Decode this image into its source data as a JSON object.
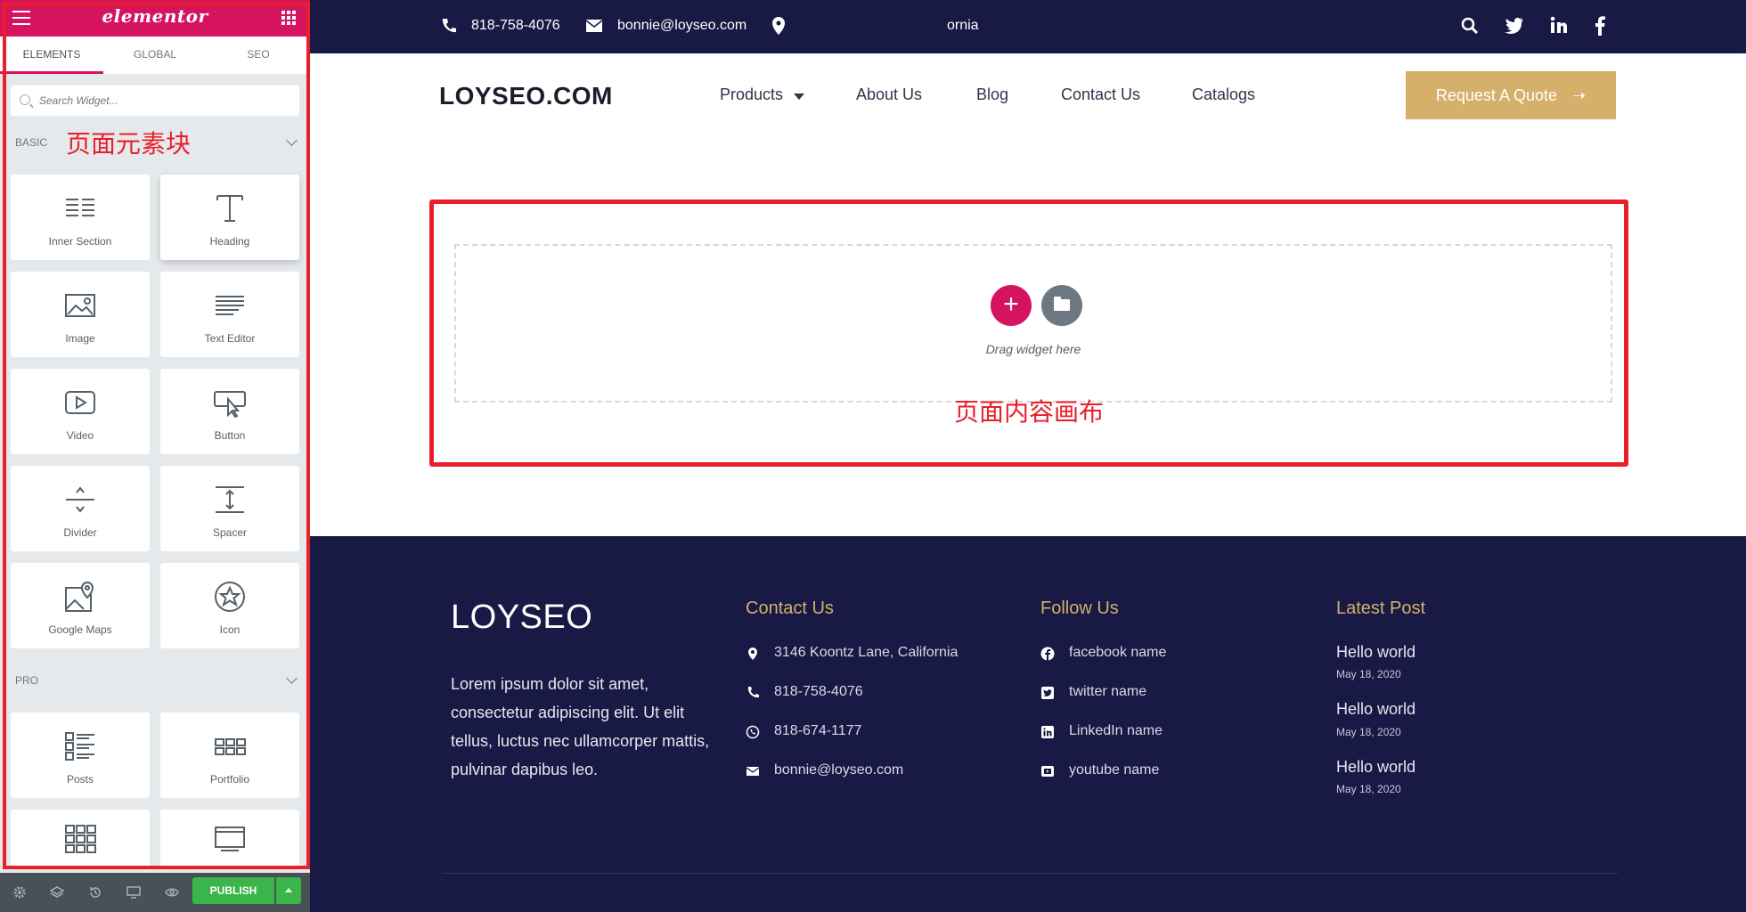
{
  "editor": {
    "logo": "elementor",
    "tabs": [
      "ELEMENTS",
      "GLOBAL",
      "SEO"
    ],
    "search_placeholder": "Search Widget...",
    "basic_label": "BASIC",
    "basic_annotation": "页面元素块",
    "pro_label": "PRO",
    "basic_widgets": [
      {
        "label": "Inner Section",
        "icon": "inner-section-icon"
      },
      {
        "label": "Heading",
        "icon": "heading-icon"
      },
      {
        "label": "Image",
        "icon": "image-icon"
      },
      {
        "label": "Text Editor",
        "icon": "text-editor-icon"
      },
      {
        "label": "Video",
        "icon": "video-icon"
      },
      {
        "label": "Button",
        "icon": "button-icon"
      },
      {
        "label": "Divider",
        "icon": "divider-icon"
      },
      {
        "label": "Spacer",
        "icon": "spacer-icon"
      },
      {
        "label": "Google Maps",
        "icon": "google-maps-icon"
      },
      {
        "label": "Icon",
        "icon": "star-icon"
      }
    ],
    "pro_widgets": [
      {
        "label": "Posts",
        "icon": "posts-icon"
      },
      {
        "label": "Portfolio",
        "icon": "portfolio-icon"
      },
      {
        "label": "",
        "icon": "gallery-icon"
      },
      {
        "label": "",
        "icon": "slides-icon"
      }
    ],
    "publish_label": "PUBLISH",
    "accent": "#d5135f",
    "publish_color": "#39b54a",
    "annotation_color": "#e8202a"
  },
  "site": {
    "topbar": {
      "phone": "818-758-4076",
      "email": "bonnie@loyseo.com",
      "location": "ornia"
    },
    "logo": "LOYSEO.COM",
    "nav": [
      "Products",
      "About Us",
      "Blog",
      "Contact Us",
      "Catalogs"
    ],
    "cta": "Request A Quote",
    "canvas": {
      "drag_text": "Drag widget here",
      "annotation": "页面内容画布"
    },
    "footer": {
      "logo": "LOYSEO",
      "description": "Lorem ipsum dolor sit amet, consectetur adipiscing elit. Ut elit tellus, luctus nec ullamcorper mattis, pulvinar dapibus leo.",
      "contact_title": "Contact Us",
      "contact": [
        {
          "icon": "map-pin-icon",
          "text": "3146 Koontz Lane, California"
        },
        {
          "icon": "phone-icon",
          "text": "818-758-4076"
        },
        {
          "icon": "whatsapp-icon",
          "text": "818-674-1177"
        },
        {
          "icon": "envelope-icon",
          "text": "bonnie@loyseo.com"
        }
      ],
      "follow_title": "Follow Us",
      "follow": [
        {
          "icon": "facebook-icon",
          "text": "facebook name"
        },
        {
          "icon": "twitter-icon",
          "text": "twitter name"
        },
        {
          "icon": "linkedin-icon",
          "text": "LinkedIn name"
        },
        {
          "icon": "youtube-icon",
          "text": "youtube name"
        }
      ],
      "posts_title": "Latest Post",
      "posts": [
        {
          "title": "Hello world",
          "date": "May 18, 2020"
        },
        {
          "title": "Hello world",
          "date": "May 18, 2020"
        },
        {
          "title": "Hello world",
          "date": "May 18, 2020"
        }
      ]
    },
    "colors": {
      "dark": "#181a45",
      "gold": "#d4b06a"
    }
  }
}
